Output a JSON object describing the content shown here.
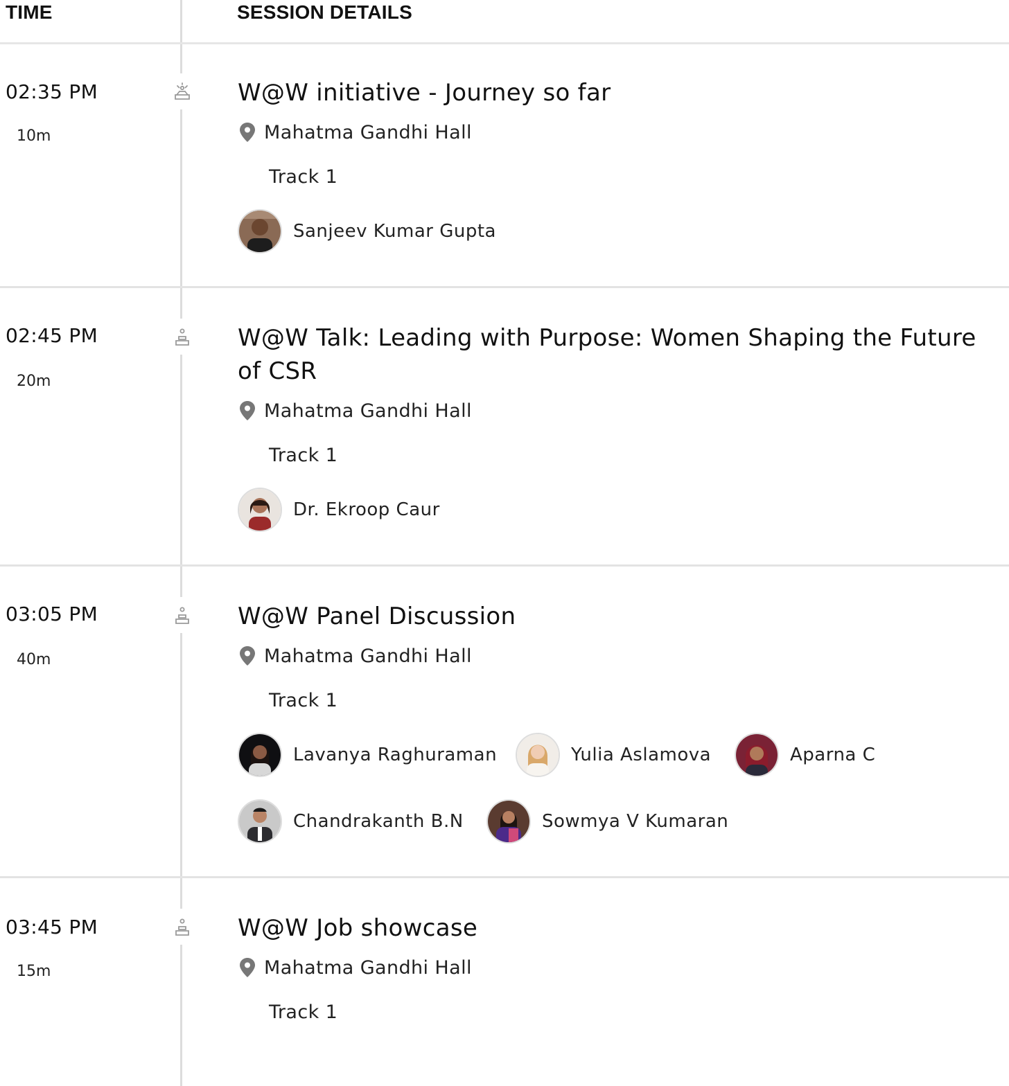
{
  "header": {
    "time_label": "TIME",
    "details_label": "SESSION DETAILS"
  },
  "sessions": [
    {
      "time": "02:35 PM",
      "duration": "10m",
      "icon": "keynote-icon",
      "title": "W@W initiative - Journey so far",
      "location": "Mahatma Gandhi Hall",
      "track": "Track 1",
      "speakers": [
        {
          "name": "Sanjeev Kumar Gupta"
        }
      ]
    },
    {
      "time": "02:45 PM",
      "duration": "20m",
      "icon": "podium-icon",
      "title": "W@W Talk: Leading with Purpose: Women Shaping the Future of CSR",
      "location": "Mahatma Gandhi Hall",
      "track": "Track 1",
      "speakers": [
        {
          "name": "Dr. Ekroop Caur"
        }
      ]
    },
    {
      "time": "03:05 PM",
      "duration": "40m",
      "icon": "podium-icon",
      "title": "W@W Panel Discussion",
      "location": "Mahatma Gandhi Hall",
      "track": "Track 1",
      "speakers": [
        {
          "name": "Lavanya Raghuraman"
        },
        {
          "name": "Yulia Aslamova"
        },
        {
          "name": "Aparna C"
        },
        {
          "name": "Chandrakanth B.N"
        },
        {
          "name": "Sowmya V Kumaran"
        }
      ]
    },
    {
      "time": "03:45 PM",
      "duration": "15m",
      "icon": "podium-icon",
      "title": "W@W Job showcase",
      "location": "Mahatma Gandhi Hall",
      "track": "Track 1",
      "speakers": []
    }
  ],
  "colors": {
    "divider": "#e3e3e3",
    "timeline": "#dcdcdc",
    "icon": "#9a9a9a",
    "pin": "#777777"
  }
}
